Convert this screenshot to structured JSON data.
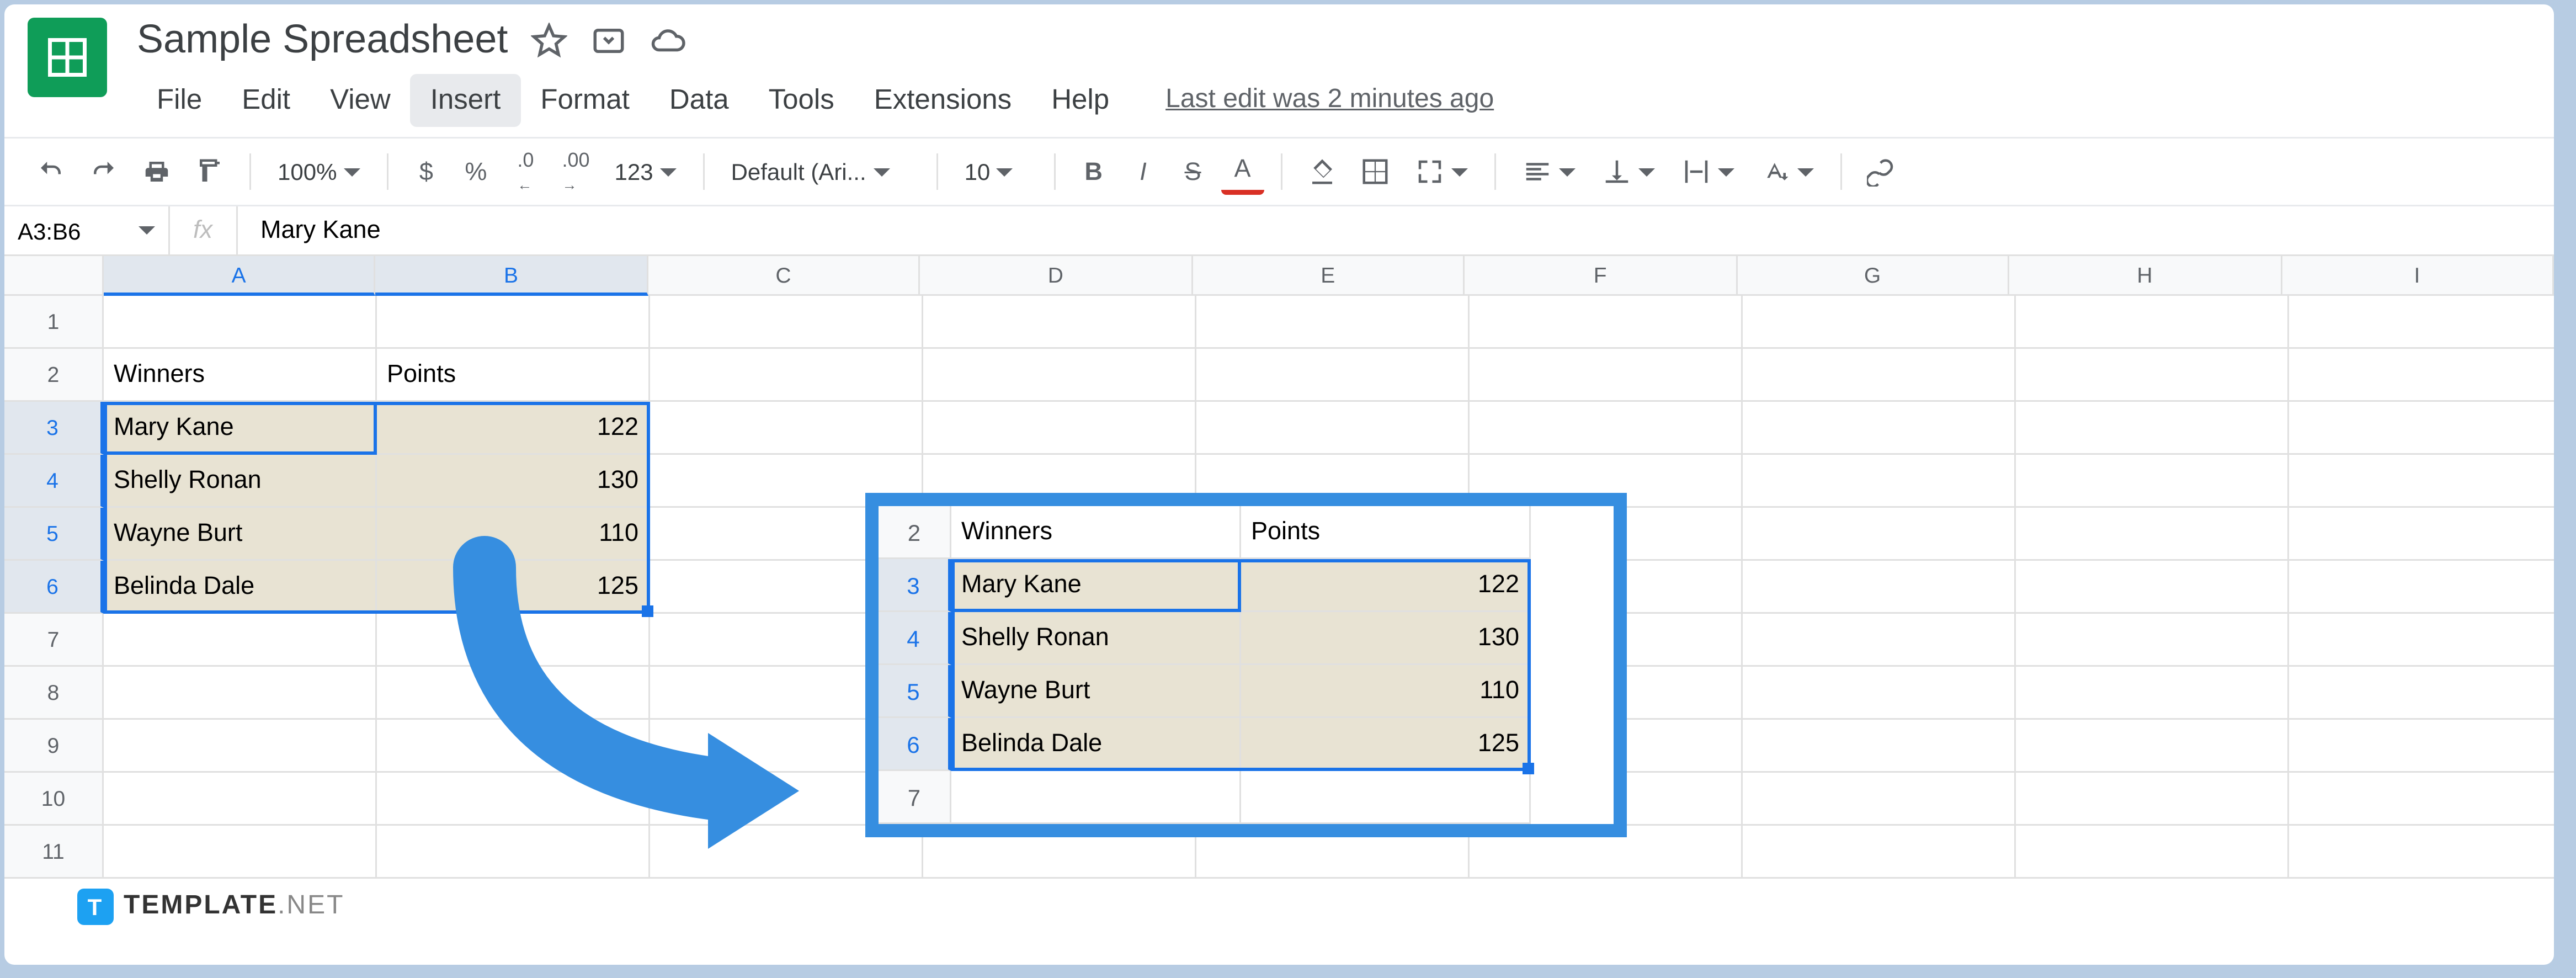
{
  "doc": {
    "title": "Sample Spreadsheet"
  },
  "menu": {
    "file": "File",
    "edit": "Edit",
    "view": "View",
    "insert": "Insert",
    "format": "Format",
    "data": "Data",
    "tools": "Tools",
    "extensions": "Extensions",
    "help": "Help",
    "last_edit": "Last edit was 2 minutes ago"
  },
  "toolbar": {
    "zoom": "100%",
    "dollar": "$",
    "percent": "%",
    "dec_dec": ".0",
    "dec_inc": ".00",
    "num_fmt": "123",
    "font": "Default (Ari...",
    "font_size": "10",
    "bold": "B",
    "italic": "I",
    "strike": "S",
    "text_color": "A"
  },
  "namebox": {
    "ref": "A3:B6"
  },
  "fx": {
    "label": "fx",
    "value": "Mary Kane"
  },
  "columns": [
    "A",
    "B",
    "C",
    "D",
    "E",
    "F",
    "G",
    "H",
    "I"
  ],
  "rows": [
    "1",
    "2",
    "3",
    "4",
    "5",
    "6",
    "7",
    "8",
    "9",
    "10",
    "11"
  ],
  "headers": {
    "a": "Winners",
    "b": "Points"
  },
  "data": [
    {
      "name": "Mary Kane",
      "points": "122"
    },
    {
      "name": "Shelly Ronan",
      "points": "130"
    },
    {
      "name": "Wayne Burt",
      "points": "110"
    },
    {
      "name": "Belinda Dale",
      "points": "125"
    }
  ],
  "callout_rows": [
    "2",
    "3",
    "4",
    "5",
    "6",
    "7"
  ],
  "watermark": {
    "brand": "TEMPLATE",
    "suffix": ".NET",
    "t": "T"
  }
}
